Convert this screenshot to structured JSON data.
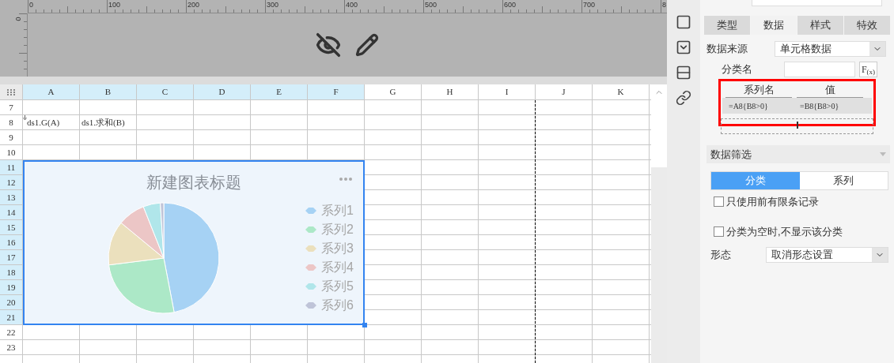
{
  "ruler": {
    "labels": [
      "0",
      "100",
      "200",
      "300",
      "400",
      "500",
      "600",
      "700",
      "8"
    ],
    "vertical_label": "0"
  },
  "sheet": {
    "columns": [
      {
        "label": "A",
        "selected": true
      },
      {
        "label": "B",
        "selected": true
      },
      {
        "label": "C",
        "selected": true
      },
      {
        "label": "D",
        "selected": true
      },
      {
        "label": "E",
        "selected": true
      },
      {
        "label": "F",
        "selected": true
      },
      {
        "label": "G",
        "selected": false
      },
      {
        "label": "H",
        "selected": false
      },
      {
        "label": "I",
        "selected": false
      },
      {
        "label": "J",
        "selected": false
      },
      {
        "label": "K",
        "selected": false
      }
    ],
    "rows": [
      {
        "label": "7",
        "selected": false,
        "cells": []
      },
      {
        "label": "8",
        "selected": false,
        "cells": [
          "ds1.G(A)",
          "ds1.求和(B)"
        ]
      },
      {
        "label": "9",
        "selected": false,
        "cells": []
      },
      {
        "label": "10",
        "selected": false,
        "cells": []
      },
      {
        "label": "11",
        "selected": true,
        "cells": []
      },
      {
        "label": "12",
        "selected": true,
        "cells": []
      },
      {
        "label": "13",
        "selected": true,
        "cells": []
      },
      {
        "label": "14",
        "selected": true,
        "cells": []
      },
      {
        "label": "15",
        "selected": true,
        "cells": []
      },
      {
        "label": "16",
        "selected": true,
        "cells": []
      },
      {
        "label": "17",
        "selected": true,
        "cells": []
      },
      {
        "label": "18",
        "selected": true,
        "cells": []
      },
      {
        "label": "19",
        "selected": true,
        "cells": []
      },
      {
        "label": "20",
        "selected": true,
        "cells": []
      },
      {
        "label": "21",
        "selected": true,
        "cells": []
      },
      {
        "label": "22",
        "selected": false,
        "cells": []
      },
      {
        "label": "23",
        "selected": false,
        "cells": []
      }
    ]
  },
  "chart": {
    "title": "新建图表标题",
    "legend": [
      {
        "label": "系列1",
        "color": "#a6d2f4"
      },
      {
        "label": "系列2",
        "color": "#ace8c7"
      },
      {
        "label": "系列3",
        "color": "#ebe0bd"
      },
      {
        "label": "系列4",
        "color": "#ecc6c6"
      },
      {
        "label": "系列5",
        "color": "#b0e6ea"
      },
      {
        "label": "系列6",
        "color": "#bfc4d8"
      }
    ]
  },
  "panel": {
    "tabs": [
      {
        "label": "类型",
        "selected": false
      },
      {
        "label": "数据",
        "selected": true
      },
      {
        "label": "样式",
        "selected": false
      },
      {
        "label": "特效",
        "selected": false
      }
    ],
    "data_source": {
      "label": "数据来源",
      "value": "单元格数据"
    },
    "category": {
      "label": "分类名",
      "button": "F$_{(x)}$"
    },
    "series_table": {
      "columns": [
        "系列名",
        "值"
      ],
      "rows": [
        [
          "=A8{B8>0}",
          "=B8{B8>0}"
        ]
      ]
    },
    "filter": {
      "title": "数据筛选",
      "segments": [
        {
          "label": "分类",
          "selected": true
        },
        {
          "label": "系列",
          "selected": false
        }
      ],
      "options": [
        {
          "label": "只使用前有限条记录",
          "checked": false
        },
        {
          "label": "分类为空时,不显示该分类",
          "checked": false
        }
      ]
    },
    "shape": {
      "label": "形态",
      "value": "取消形态设置"
    }
  }
}
